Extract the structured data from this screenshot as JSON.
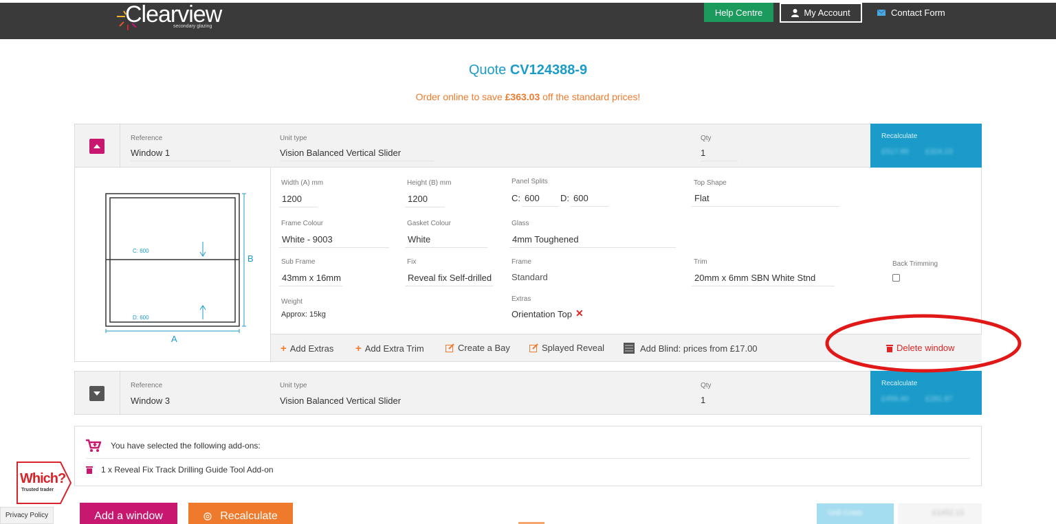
{
  "header": {
    "logo_text": "Clearview",
    "logo_sub": "secondary glazing",
    "help_label": "Help Centre",
    "account_label": "My Account",
    "contact_label": "Contact Form"
  },
  "quote": {
    "prefix": "Quote",
    "number": "CV124388-9",
    "promo_before": "Order online to save",
    "promo_amount": "£363.03",
    "promo_after": "off the standard prices!"
  },
  "window1": {
    "ref_label": "Reference",
    "ref_value": "Window 1",
    "unit_label": "Unit type",
    "unit_value": "Vision Balanced Vertical Slider",
    "qty_label": "Qty",
    "qty_value": "1",
    "recalc_label": "Recalculate",
    "price_old": "£517.85",
    "price_new": "£324.15",
    "fields": {
      "width_label": "Width (A) mm",
      "width_value": "1200",
      "height_label": "Height (B) mm",
      "height_value": "1200",
      "splits_label": "Panel Splits",
      "split_c_label": "C:",
      "split_c_value": "600",
      "split_d_label": "D:",
      "split_d_value": "600",
      "top_shape_label": "Top Shape",
      "top_shape_value": "Flat",
      "frame_colour_label": "Frame Colour",
      "frame_colour_value": "White - 9003",
      "gasket_label": "Gasket Colour",
      "gasket_value": "White",
      "glass_label": "Glass",
      "glass_value": "4mm Toughened",
      "subframe_label": "Sub Frame",
      "subframe_value": "43mm x 16mm",
      "fix_label": "Fix",
      "fix_value": "Reveal fix Self-drilled",
      "frame_label": "Frame",
      "frame_value": "Standard",
      "trim_label": "Trim",
      "trim_value": "20mm x 6mm SBN White Stnd",
      "back_trim_label": "Back Trimming",
      "weight_label": "Weight",
      "weight_value": "Approx: 15kg",
      "extras_label": "Extras",
      "extras_value": "Orientation Top"
    },
    "diagram": {
      "c_label": "C: 600",
      "d_label": "D: 600",
      "a_label": "A",
      "b_label": "B"
    },
    "actions": {
      "add_extras": "Add Extras",
      "add_extra_trim": "Add Extra Trim",
      "create_bay": "Create a Bay",
      "splayed_reveal": "Splayed Reveal",
      "add_blind": "Add Blind: prices from £17.00",
      "delete_window": "Delete window"
    }
  },
  "window3": {
    "ref_label": "Reference",
    "ref_value": "Window 3",
    "unit_label": "Unit type",
    "unit_value": "Vision Balanced Vertical Slider",
    "qty_label": "Qty",
    "qty_value": "1",
    "recalc_label": "Recalculate",
    "price_old": "£456.40",
    "price_new": "£281.87"
  },
  "addons": {
    "heading": "You have selected the following add-ons:",
    "item": "1 x Reveal Fix Track Drilling Guide Tool Add-on"
  },
  "footer": {
    "which_text": "Which?",
    "which_sub": "Trusted trader",
    "privacy": "Privacy Policy",
    "add_window": "Add a window",
    "recalculate": "Recalculate",
    "unit_costs": "Unit Costs",
    "total": "£1452.13"
  },
  "colors": {
    "brand_blue": "#1a9bc9",
    "brand_magenta": "#c8176f",
    "brand_orange": "#f07a2c",
    "help_green": "#1a9a5c",
    "delete_red": "#e02424"
  }
}
